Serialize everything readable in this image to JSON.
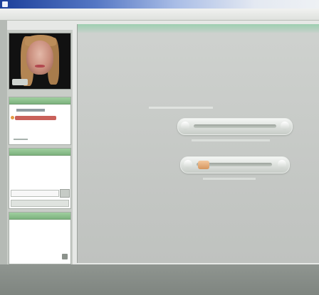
{
  "window": {
    "title": ""
  },
  "menu": [],
  "sidebar": {
    "video": {
      "description_icon": "webcam-video-feed"
    },
    "panels": [
      {
        "name": "contacts-panel"
      },
      {
        "name": "chat-panel"
      },
      {
        "name": "notes-panel"
      }
    ]
  },
  "main": {
    "controls": [
      {
        "name": "volume-slider"
      },
      {
        "name": "progress-slider",
        "level": 0.15
      }
    ]
  },
  "colors": {
    "title_bar_start": "#1c3f9a",
    "panel_header": "#7db27e",
    "accent_orange": "#d5965e",
    "alert_red": "#c9605a"
  }
}
